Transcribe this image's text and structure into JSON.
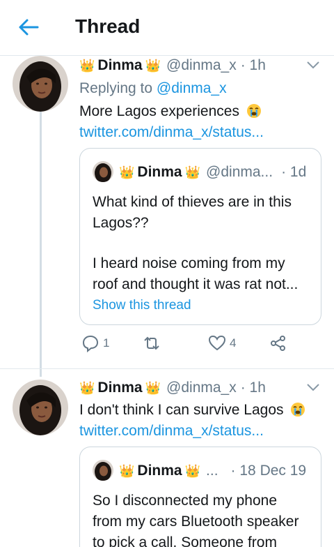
{
  "header": {
    "title": "Thread"
  },
  "tweet1": {
    "name": "Dinma",
    "handle": "@dinma_x",
    "time": "· 1h",
    "replying_prefix": "Replying to ",
    "replying_handle": "@dinma_x",
    "text": "More Lagos experiences",
    "link": "twitter.com/dinma_x/status...",
    "quote": {
      "name": "Dinma",
      "handle": "@dinma...",
      "time": "· 1d",
      "line1": "What kind of thieves are in this",
      "line2": "Lagos??",
      "line3": "I heard noise coming from my",
      "line4": "roof and thought it was rat not...",
      "show_thread": "Show this thread"
    },
    "replies": "1",
    "likes": "4"
  },
  "tweet2": {
    "name": "Dinma",
    "handle": "@dinma_x",
    "time": "· 1h",
    "text": "I don't think I can survive Lagos",
    "link": "twitter.com/dinma_x/status...",
    "quote": {
      "name": "Dinma",
      "handle": "...",
      "time": "· 18 Dec 19",
      "line1": "So I disconnected my phone",
      "line2": "from my cars Bluetooth speaker",
      "line3": "to pick a call. Someone from"
    }
  },
  "colors": {
    "accent": "#1b95e0",
    "muted": "#657786",
    "border": "#ccd6dd"
  }
}
